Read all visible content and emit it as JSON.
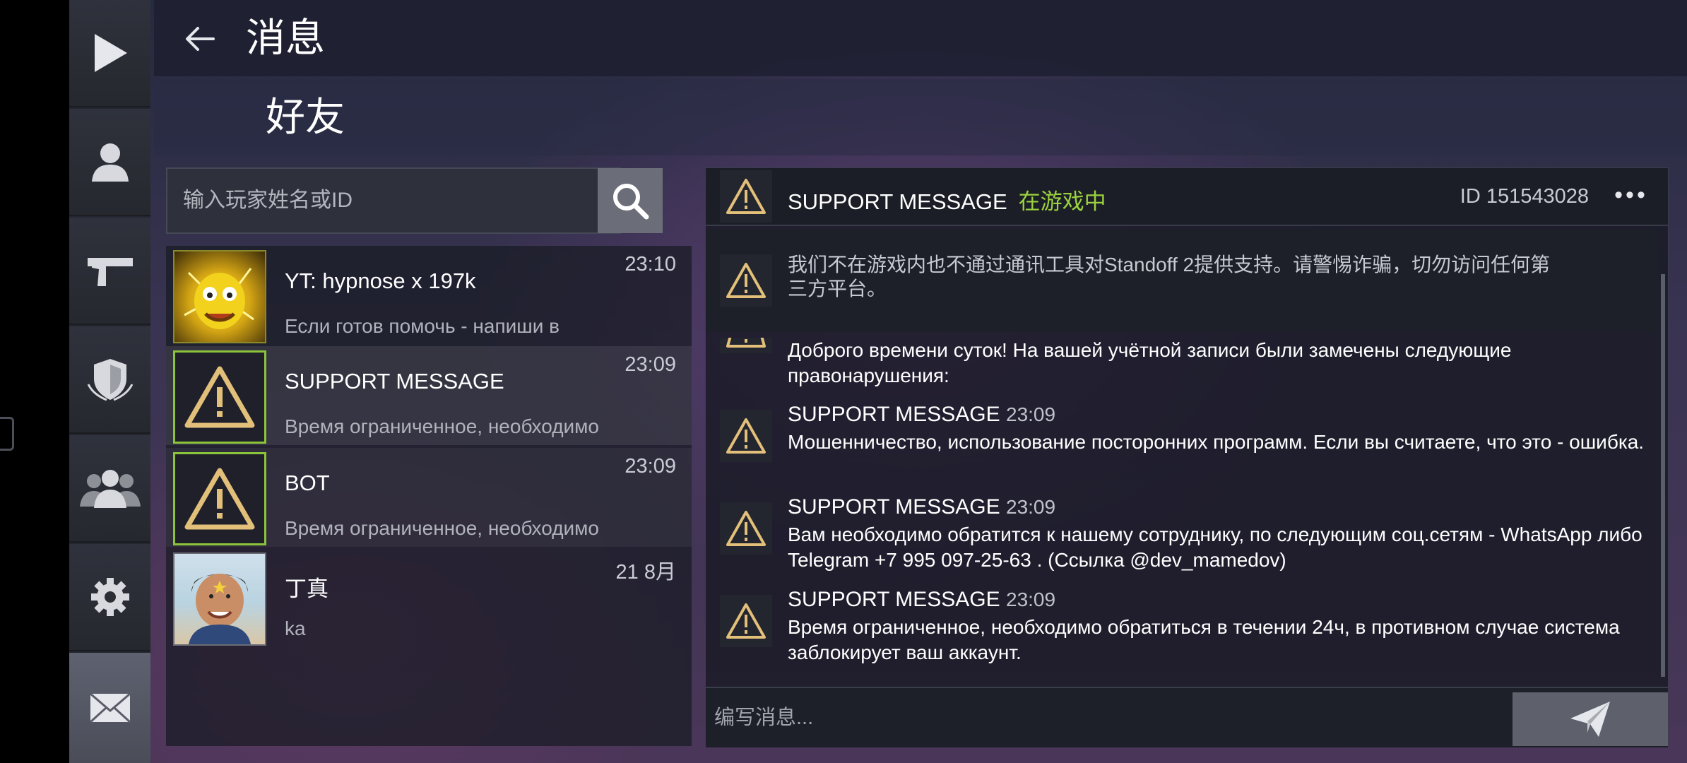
{
  "header": {
    "title": "消息"
  },
  "section": {
    "title": "好友"
  },
  "search": {
    "placeholder": "输入玩家姓名或ID"
  },
  "sidebar": {
    "items": [
      {
        "icon": "play-icon"
      },
      {
        "icon": "profile-icon"
      },
      {
        "icon": "pistol-icon"
      },
      {
        "icon": "clan-shield-icon"
      },
      {
        "icon": "friends-icon"
      },
      {
        "icon": "settings-gear-icon"
      },
      {
        "icon": "mail-icon",
        "active": true
      }
    ]
  },
  "contacts": [
    {
      "name": "YT: hypnose x 197k",
      "time": "23:10",
      "preview": "Если готов помочь - напиши в",
      "avatar": "cartoon-avatar"
    },
    {
      "name": "SUPPORT MESSAGE",
      "time": "23:09",
      "preview": "Время ограниченное, необходимо",
      "avatar": "warning-icon",
      "selected": true
    },
    {
      "name": "BOT",
      "time": "23:09",
      "preview": "Время ограниченное, необходимо",
      "avatar": "warning-icon"
    },
    {
      "name": "丁真",
      "time": "21 8月",
      "preview": "ka",
      "avatar": "photo-avatar"
    }
  ],
  "chat": {
    "name": "SUPPORT MESSAGE",
    "status": "在游戏中",
    "id": "ID 151543028",
    "more": "•••",
    "notice": "我们不在游戏内也不通过通讯工具对Standoff 2提供支持。请警惕诈骗，切勿访问任何第三方平台。",
    "messages": [
      {
        "sender": "",
        "time": "",
        "text": "Доброго времени суток! На вашей учётной записи были замечены следующие правонарушения:"
      },
      {
        "sender": "SUPPORT MESSAGE",
        "time": "23:09",
        "text": "Мошенничество, использование посторонних программ. Если вы считаете, что это - ошибка."
      },
      {
        "sender": "SUPPORT MESSAGE",
        "time": "23:09",
        "text": "Вам необходимо обратится к нашему сотруднику, по следующим соц.сетям - WhatsApp либо Telegram  +7 995 097-25-63 . (Ссылка @dev_mamedov)"
      },
      {
        "sender": "SUPPORT MESSAGE",
        "time": "23:09",
        "text": "Время ограниченное, необходимо обратиться в течении 24ч, в противном случае система заблокирует ваш аккаунт."
      }
    ]
  },
  "composer": {
    "placeholder": "编写消息..."
  },
  "colors": {
    "accent_green": "#9bd23e",
    "warning_gold": "#e2c07a",
    "avatar_border": "#8bc43a"
  }
}
